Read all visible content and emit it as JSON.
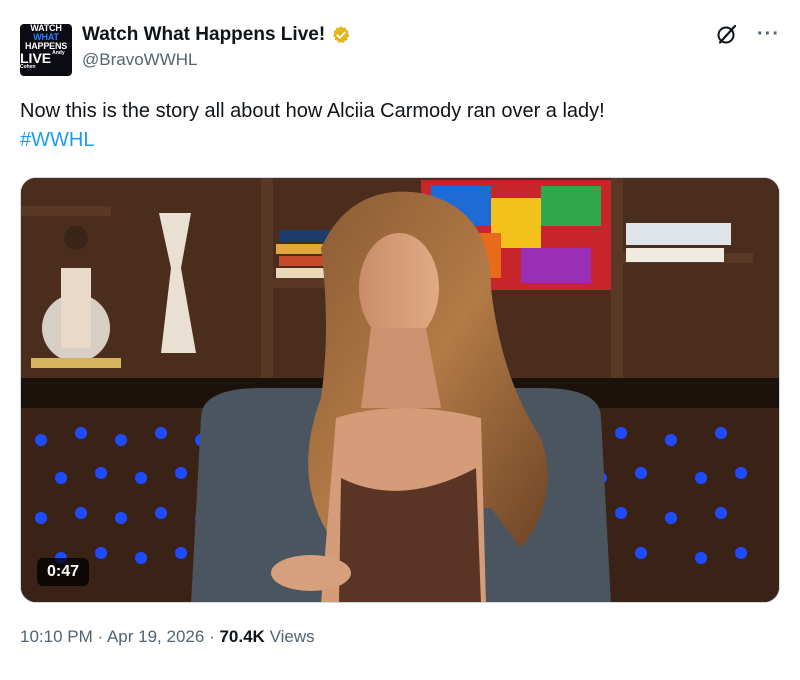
{
  "account": {
    "display_name": "Watch What Happens Live!",
    "handle": "@BravoWWHL",
    "verified": true,
    "avatar_lines": [
      "WATCH",
      "WHAT",
      "HAPPENS",
      "LIVE"
    ],
    "avatar_small": "Andy Cohen"
  },
  "tweet": {
    "text": "Now this is the story all about how Alciia Carmody ran over a lady!",
    "hashtag": "#WWHL"
  },
  "media": {
    "type": "video",
    "duration": "0:47"
  },
  "meta": {
    "time": "10:10 PM",
    "separator": "·",
    "date": "Apr 19, 2026",
    "views_count": "70.4K",
    "views_label": "Views"
  },
  "icons": {
    "verified": "gold-verified-badge-icon",
    "grok": "grok-icon",
    "more": "more-options-icon"
  },
  "colors": {
    "text": "#0f1419",
    "secondary": "#536471",
    "link": "#1d9bf0",
    "verified_gold": "#e2b719"
  }
}
